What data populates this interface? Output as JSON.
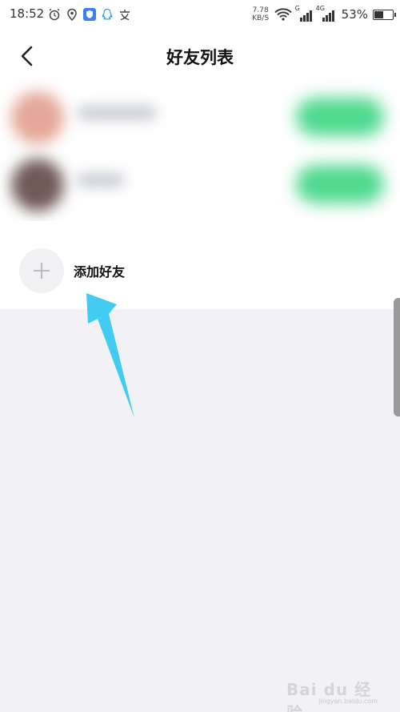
{
  "status_bar": {
    "time": "18:52",
    "icons_left": [
      "alarm-icon",
      "location-icon",
      "shield-app-icon",
      "qq-icon",
      "wenku-icon"
    ],
    "net_speed_value": "7.78",
    "net_speed_unit": "KB/S",
    "signal_1_label": "G",
    "signal_2_label": "4G",
    "battery_pct": "53%",
    "battery_level": 0.53
  },
  "header": {
    "title": "好友列表",
    "back_icon": "chevron-left-icon"
  },
  "friends": [
    {
      "avatar_color": "#e4a898"
    },
    {
      "avatar_color": "#6f5a58"
    }
  ],
  "add_friend": {
    "label": "添加好友",
    "icon": "plus-icon"
  },
  "annotation": {
    "color": "#43ccf2"
  },
  "watermark": {
    "brand": "Bai du 经验",
    "url": "jingyan.baidu.com"
  }
}
